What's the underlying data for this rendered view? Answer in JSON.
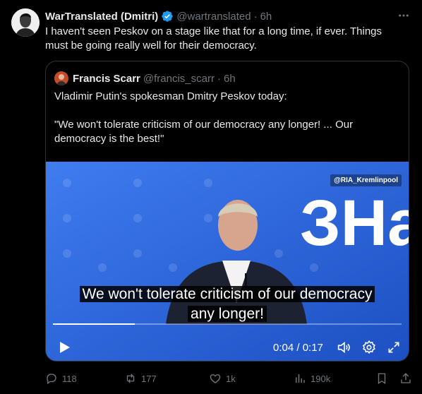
{
  "post": {
    "author_name": "WarTranslated (Dmitri)",
    "handle": "@wartranslated",
    "separator": "·",
    "time": "6h",
    "text": "I haven't seen Peskov on a stage like that for a long time, if ever. Things must be going really well for their democracy."
  },
  "quote": {
    "author_name": "Francis Scarr",
    "handle": "@francis_scarr",
    "separator": "·",
    "time": "6h",
    "text": "Vladimir Putin's spokesman Dmitry Peskov today:\n\n\"We won't tolerate criticism of our democracy any longer! ... Our democracy is the best!\""
  },
  "video": {
    "watermark": "@RIA_Kremlinpool",
    "backdrop_text": "ЗНа",
    "caption_line1": "We won't tolerate criticism of our democracy",
    "caption_line2": "any longer!",
    "timecode": "0:04 / 0:17",
    "progress": 0.235
  },
  "actions": {
    "replies": "118",
    "reposts": "177",
    "likes": "1k",
    "views": "190k"
  },
  "colors": {
    "background": "#000000",
    "text": "#e7e9ea",
    "muted": "#71767b",
    "verified": "#1d9bf0",
    "border": "#2f3336"
  }
}
